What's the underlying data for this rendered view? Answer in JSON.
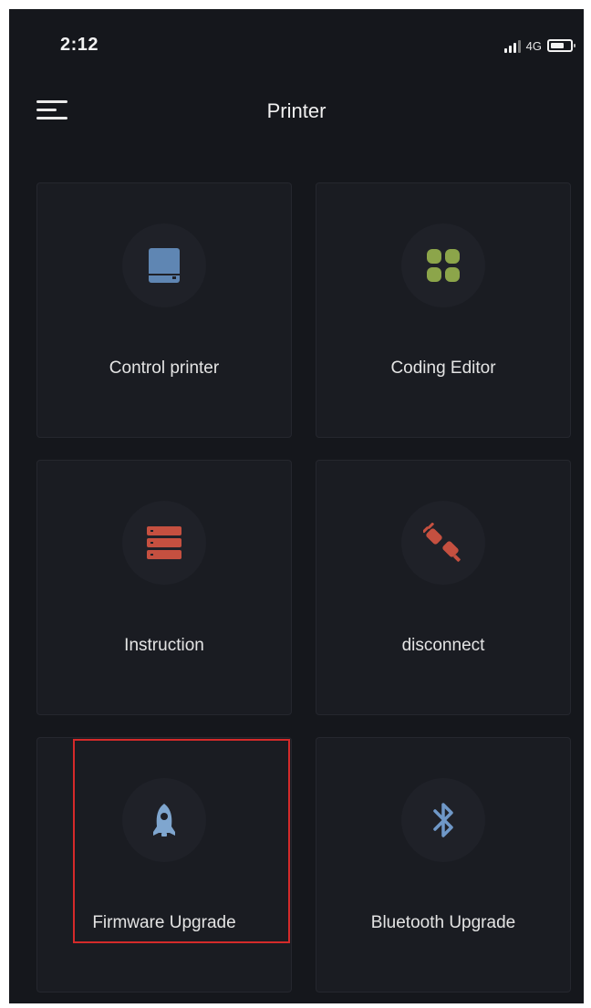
{
  "status_bar": {
    "time": "2:12",
    "network": "4G",
    "battery_level": 0.7
  },
  "header": {
    "title": "Printer",
    "menu_icon": "hamburger-menu-icon"
  },
  "tiles": [
    {
      "label": "Control printer",
      "icon": "printer-icon",
      "color": "#5f86b3"
    },
    {
      "label": "Coding Editor",
      "icon": "four-leaf-grid-icon",
      "color": "#8ca54a"
    },
    {
      "label": "Instruction",
      "icon": "stacked-list-icon",
      "color": "#c55040"
    },
    {
      "label": "disconnect",
      "icon": "unplugged-icon",
      "color": "#c55040"
    },
    {
      "label": "Firmware Upgrade",
      "icon": "rocket-icon",
      "color": "#7fa6cf",
      "highlighted": true
    },
    {
      "label": "Bluetooth Upgrade",
      "icon": "bluetooth-icon",
      "color": "#6f98c8"
    }
  ],
  "colors": {
    "background": "#15171c",
    "tile": "#1a1c22",
    "highlight": "#d42a2a"
  }
}
